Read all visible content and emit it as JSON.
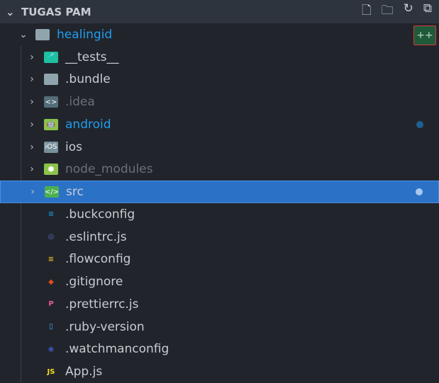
{
  "explorer": {
    "title": "TUGAS PAM",
    "actions": [
      "new-file",
      "new-folder",
      "refresh",
      "collapse-all"
    ]
  },
  "root": {
    "label": "healingid",
    "badge": "++"
  },
  "items": [
    {
      "label": "__tests__",
      "type": "folder",
      "icon": "test-folder-icon",
      "color": "#1fbfa0"
    },
    {
      "label": ".bundle",
      "type": "folder",
      "icon": "folder-icon",
      "color": "#90a4ae"
    },
    {
      "label": ".idea",
      "type": "folder",
      "icon": "idea-folder-icon",
      "color": "#546e7a"
    },
    {
      "label": "android",
      "type": "folder",
      "icon": "android-folder-icon",
      "color": "#8bc34a"
    },
    {
      "label": "ios",
      "type": "folder",
      "icon": "ios-folder-icon",
      "color": "#78909c"
    },
    {
      "label": "node_modules",
      "type": "folder",
      "icon": "node-folder-icon",
      "color": "#8bc34a"
    },
    {
      "label": "src",
      "type": "folder",
      "icon": "src-folder-icon",
      "color": "#4caf50"
    },
    {
      "label": ".buckconfig",
      "type": "file",
      "icon": "buck-icon",
      "color": "#1a8fc9"
    },
    {
      "label": ".eslintrc.js",
      "type": "file",
      "icon": "eslint-icon",
      "color": "#5c6bc0"
    },
    {
      "label": ".flowconfig",
      "type": "file",
      "icon": "flow-icon",
      "color": "#e5b22c"
    },
    {
      "label": ".gitignore",
      "type": "file",
      "icon": "git-icon",
      "color": "#e64a19"
    },
    {
      "label": ".prettierrc.js",
      "type": "file",
      "icon": "prettier-icon",
      "color": "#e9579b"
    },
    {
      "label": ".ruby-version",
      "type": "file",
      "icon": "file-icon",
      "color": "#42a5f5"
    },
    {
      "label": ".watchmanconfig",
      "type": "file",
      "icon": "watchman-icon",
      "color": "#3f51b5"
    },
    {
      "label": "App.js",
      "type": "file",
      "icon": "js-icon",
      "color": "#f5de19"
    }
  ],
  "glyphs": [
    "🧪",
    "",
    "<>",
    "🤖",
    "iOS",
    "⬢",
    "</>",
    "≋",
    "◎",
    "≡",
    "◆",
    "P",
    "",
    "◉",
    "JS"
  ]
}
